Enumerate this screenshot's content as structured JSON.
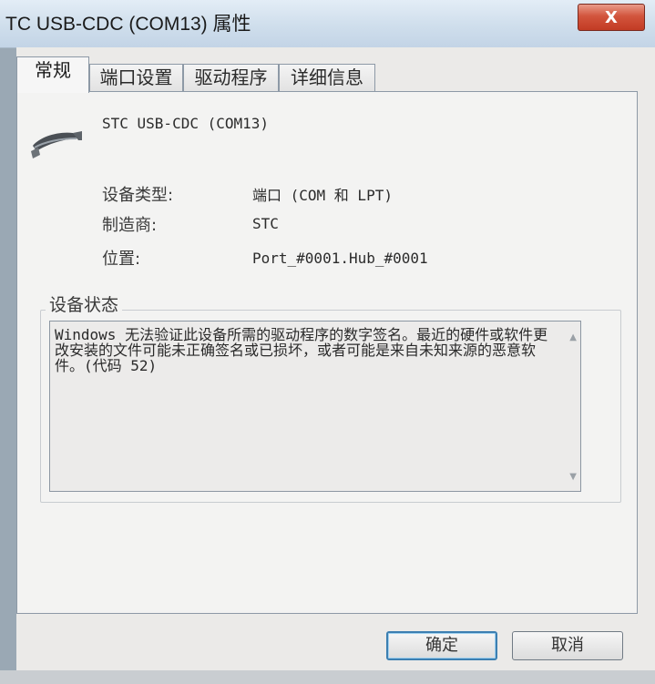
{
  "window": {
    "title": "TC USB-CDC (COM13) 属性",
    "close_label": "X"
  },
  "tabs": [
    {
      "label": "常规",
      "active": true
    },
    {
      "label": "端口设置",
      "active": false
    },
    {
      "label": "驱动程序",
      "active": false
    },
    {
      "label": "详细信息",
      "active": false
    }
  ],
  "device": {
    "name": "STC USB-CDC (COM13)",
    "icon": "usb-cable-icon"
  },
  "properties": [
    {
      "label": "设备类型:",
      "value": "端口 (COM 和 LPT)"
    },
    {
      "label": "制造商:",
      "value": "STC"
    },
    {
      "label": "位置:",
      "value": "Port_#0001.Hub_#0001"
    }
  ],
  "status": {
    "group_label": "设备状态",
    "text": "Windows 无法验证此设备所需的驱动程序的数字签名。最近的硬件或软件更改安装的文件可能未正确签名或已损坏，或者可能是来自未知来源的恶意软件。(代码 52)"
  },
  "buttons": {
    "ok": "确定",
    "cancel": "取消"
  },
  "colors": {
    "close_button": "#c23b24",
    "titlebar": "#cfdeec",
    "ok_border": "#3c7fb1"
  }
}
